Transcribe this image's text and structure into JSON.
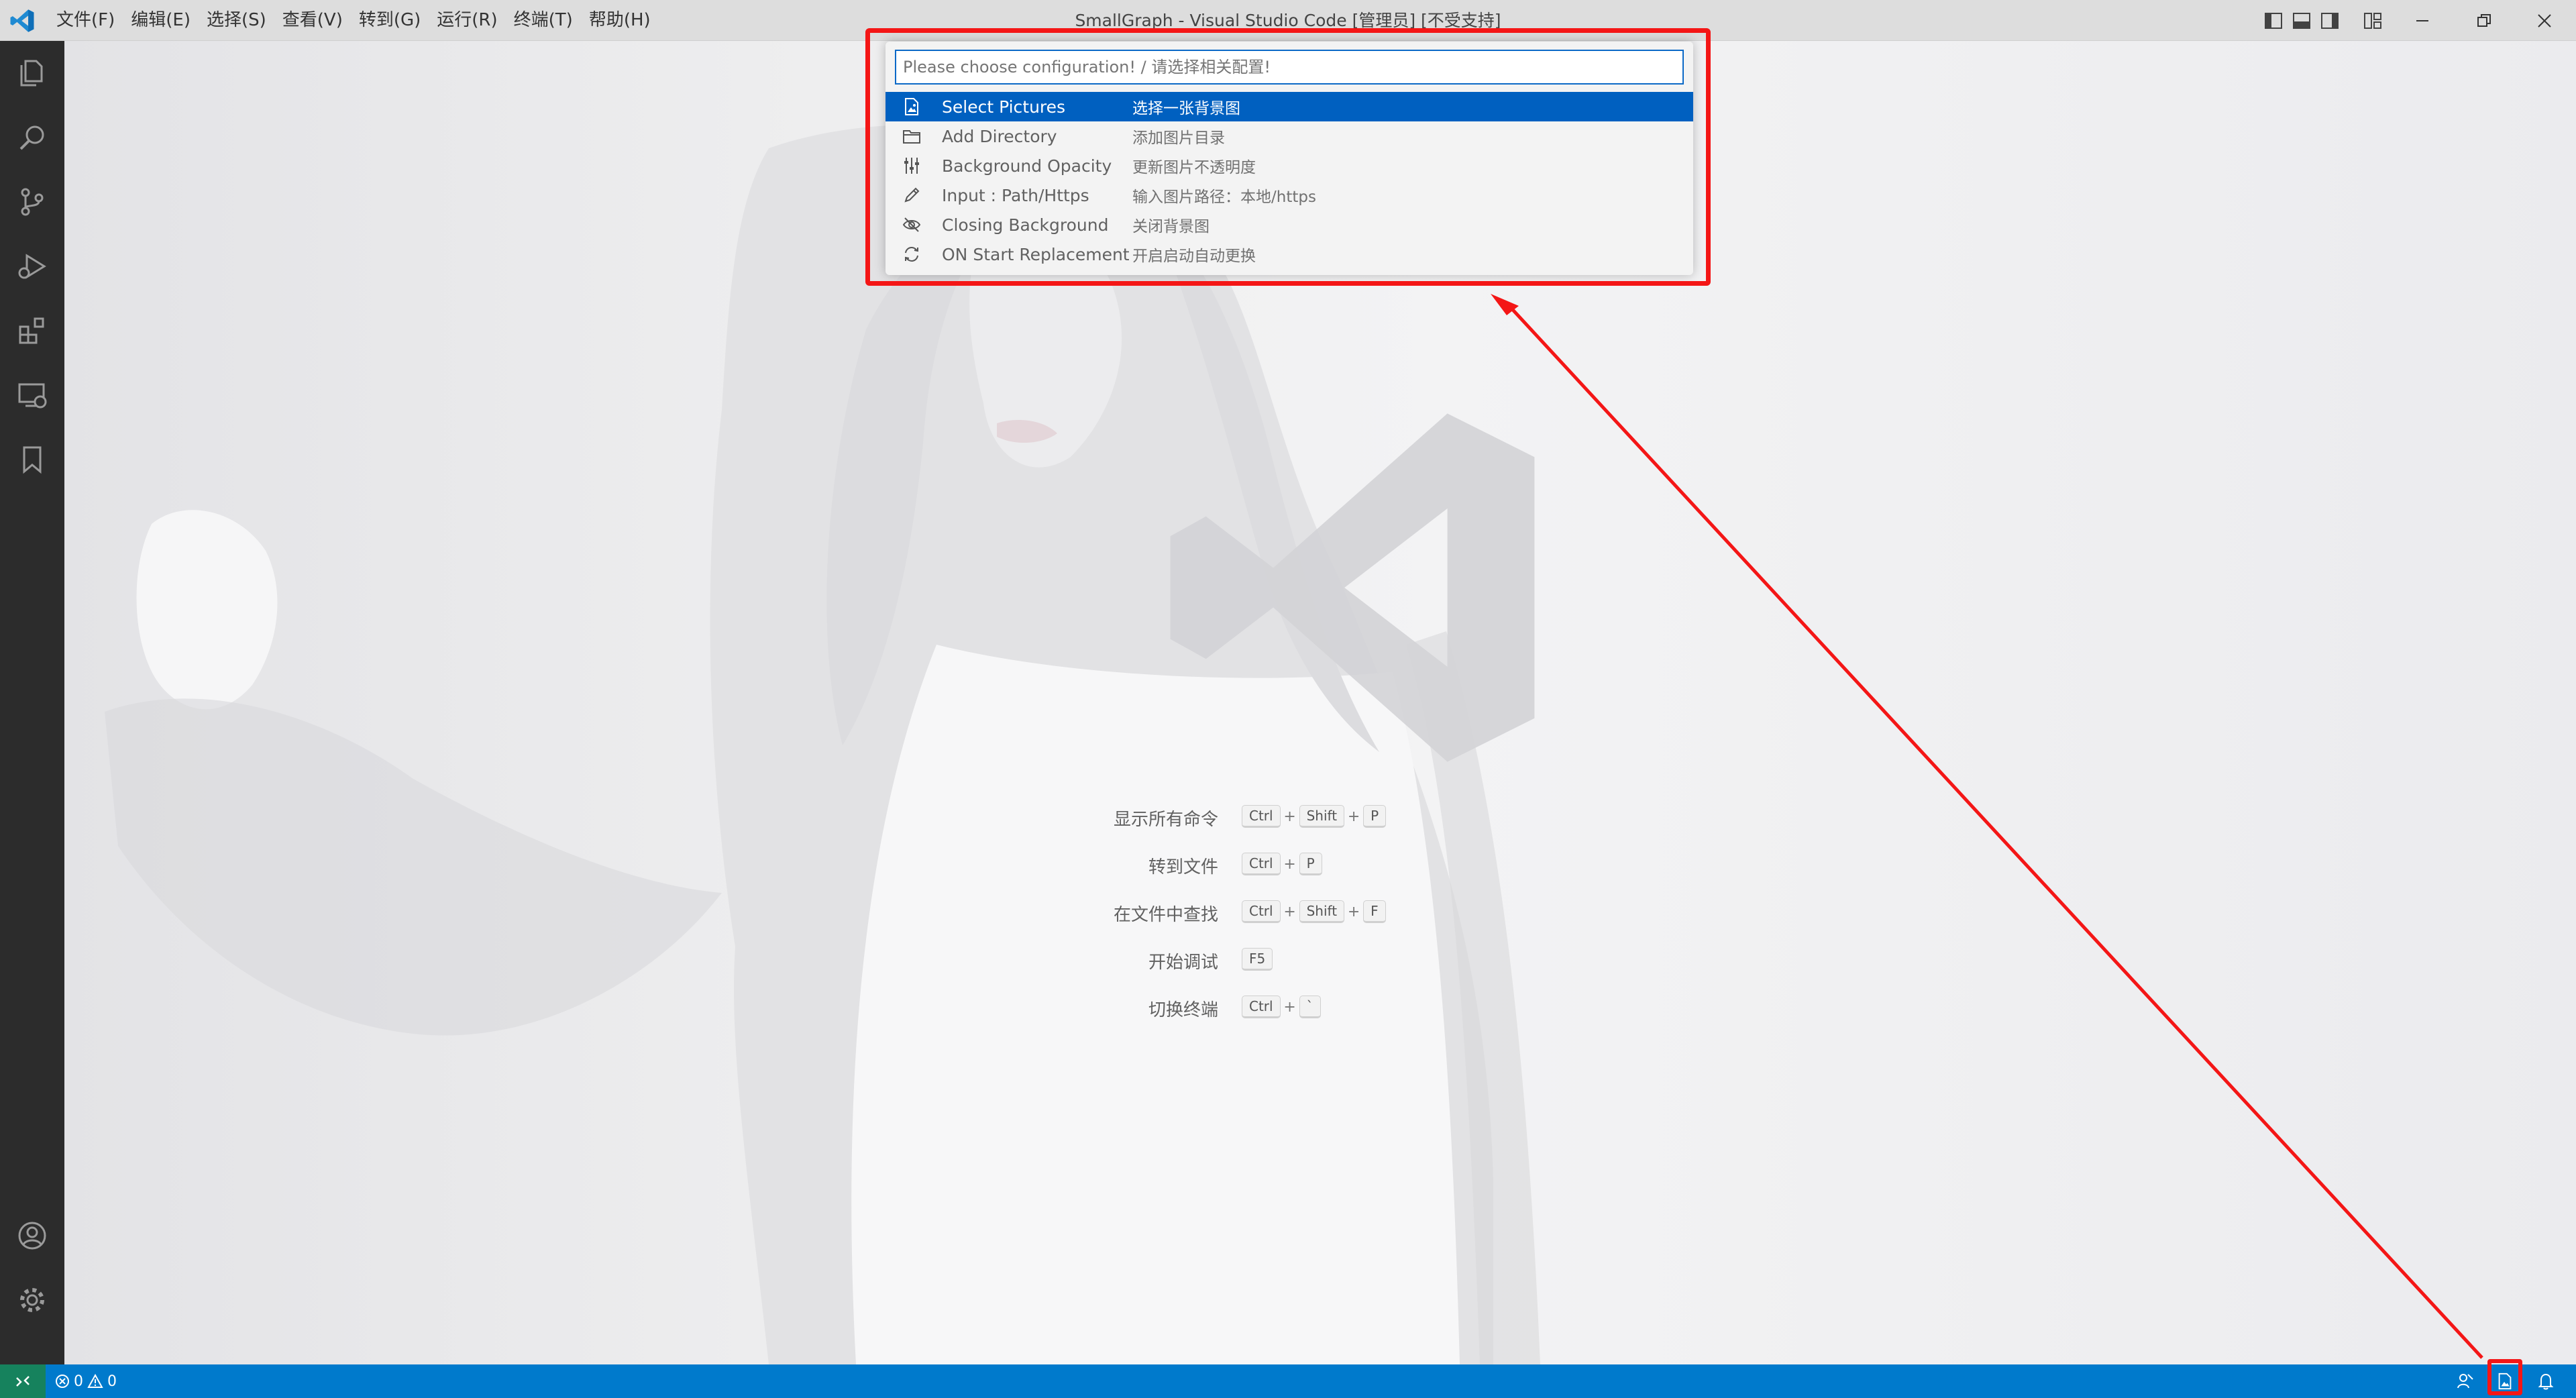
{
  "titlebar": {
    "window_title": "SmallGraph - Visual Studio Code [管理员] [不受支持]",
    "menu": [
      "文件(F)",
      "编辑(E)",
      "选择(S)",
      "查看(V)",
      "转到(G)",
      "运行(R)",
      "终端(T)",
      "帮助(H)"
    ]
  },
  "quick_pick": {
    "placeholder": "Please choose configuration! / 请选择相关配置!",
    "items": [
      {
        "label": "Select Pictures",
        "description": "选择一张背景图",
        "icon": "image-file-icon",
        "selected": true
      },
      {
        "label": "Add Directory",
        "description": "添加图片目录",
        "icon": "folder-icon",
        "selected": false
      },
      {
        "label": "Background Opacity",
        "description": "更新图片不透明度",
        "icon": "sliders-icon",
        "selected": false
      },
      {
        "label": "Input : Path/Https",
        "description": "输入图片路径：本地/https",
        "icon": "pencil-icon",
        "selected": false
      },
      {
        "label": "Closing Background",
        "description": "关闭背景图",
        "icon": "eye-closed-icon",
        "selected": false
      },
      {
        "label": "ON Start Replacement",
        "description": "开启启动自动更换",
        "icon": "sync-icon",
        "selected": false
      }
    ]
  },
  "shortcuts": [
    {
      "label": "显示所有命令",
      "keys": [
        "Ctrl",
        "Shift",
        "P"
      ]
    },
    {
      "label": "转到文件",
      "keys": [
        "Ctrl",
        "P"
      ]
    },
    {
      "label": "在文件中查找",
      "keys": [
        "Ctrl",
        "Shift",
        "F"
      ]
    },
    {
      "label": "开始调试",
      "keys": [
        "F5"
      ]
    },
    {
      "label": "切换终端",
      "keys": [
        "Ctrl",
        "`"
      ]
    }
  ],
  "statusbar": {
    "errors": "0",
    "warnings": "0"
  },
  "colors": {
    "accent": "#007acc",
    "selection": "#0060c0",
    "annotation": "#f41616",
    "remote": "#16825d"
  }
}
